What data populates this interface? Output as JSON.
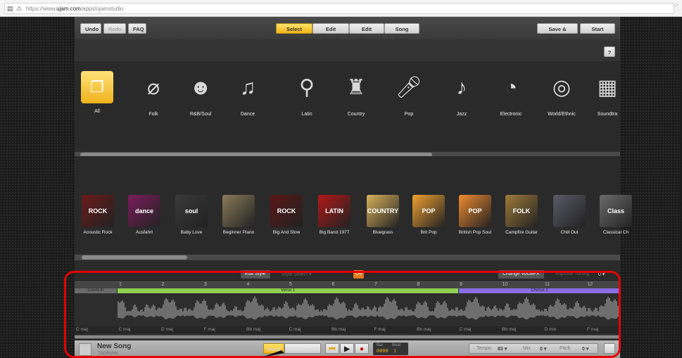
{
  "browser": {
    "url_prefix": "https://www.",
    "url_domain": "ujam.com",
    "url_path": "/apps/ujamstudio"
  },
  "toolbar": {
    "undo": "Undo",
    "redo": "Redo",
    "faq": "FAQ",
    "tabs": [
      "Select Style",
      "Edit Melody",
      "Edit Chords",
      "Song Form"
    ],
    "save_share": "Save & Share",
    "start_over": "Start Over",
    "help": "?"
  },
  "genres": [
    {
      "label": "All",
      "icon": "stack-icon"
    },
    {
      "label": "Folk",
      "icon": "banjo-icon"
    },
    {
      "label": "R&B/Soul",
      "icon": "face-icon"
    },
    {
      "label": "Dance",
      "icon": "headphones-icon"
    },
    {
      "label": "Latin",
      "icon": "maraca-icon"
    },
    {
      "label": "Country",
      "icon": "boot-icon"
    },
    {
      "label": "Pop",
      "icon": "microphone-icon"
    },
    {
      "label": "Jazz",
      "icon": "saxophone-icon"
    },
    {
      "label": "Electronic",
      "icon": "swirl-icon"
    },
    {
      "label": "World/Ethnic",
      "icon": "spiral-icon"
    },
    {
      "label": "Soundtra",
      "icon": "film-icon"
    }
  ],
  "styles": [
    {
      "label": "Acoustic Rock",
      "art": "ROCK",
      "color": "#6b1a1a"
    },
    {
      "label": "Ausfahrt",
      "art": "dance",
      "color": "#7a1c5c"
    },
    {
      "label": "Baby Love",
      "art": "soul",
      "color": "#3a3a3a"
    },
    {
      "label": "Beginner Piano",
      "art": "",
      "color": "#8a7a5a"
    },
    {
      "label": "Big And Slow",
      "art": "ROCK",
      "color": "#5a1616"
    },
    {
      "label": "Big Band 1977",
      "art": "LATIN",
      "color": "#b01818"
    },
    {
      "label": "Bluegrass",
      "art": "COUNTRY",
      "color": "#d9b25a"
    },
    {
      "label": "Brit Pop",
      "art": "POP",
      "color": "#f0a030"
    },
    {
      "label": "British Pop Soul",
      "art": "POP",
      "color": "#f08a30"
    },
    {
      "label": "Campfire Guitar",
      "art": "FOLK",
      "color": "#a07a3a"
    },
    {
      "label": "Chill Out",
      "art": "",
      "color": "#5a5a6a"
    },
    {
      "label": "Classical Ch",
      "art": "Class",
      "color": "#6a6a6a"
    }
  ],
  "editor": {
    "edit_style": "Edit Style",
    "style_select": "Style Select",
    "off": "Off",
    "change_vocalfx": "Change VocalFX",
    "improve_tuning": "Improve Tuning",
    "tuning_value": "0",
    "bars": [
      "1",
      "2",
      "3",
      "4",
      "5",
      "6",
      "7",
      "8",
      "9",
      "10",
      "11",
      "12"
    ],
    "parts": [
      {
        "label": "Count-In",
        "color": "#6a6a6a"
      },
      {
        "label": "Verse 1",
        "color": "#8fd14f"
      },
      {
        "label": "Chorus 1",
        "color": "#8a6ee6"
      }
    ],
    "chords": [
      "C maj",
      "C maj",
      "D maj",
      "F maj",
      "Bb maj",
      "C maj",
      "Bb maj",
      "F maj",
      "Bb maj",
      "C maj",
      "Bb maj",
      "D min",
      "F maj"
    ]
  },
  "footer": {
    "song_title": "New Song",
    "artist": "TADRIAN",
    "vocal": "Vocal",
    "instrument": "Instrument",
    "bar_label": "Bar",
    "beat_label": "Beat",
    "bar_value": "0000",
    "beat_value": "1",
    "tempo_label": "Tempo",
    "tempo_value": "83 ▾",
    "mix_label": "Mix",
    "mix_value": "0 ▾",
    "pitch_label": "Pitch",
    "pitch_value": "0 ▾",
    "help": "?"
  }
}
